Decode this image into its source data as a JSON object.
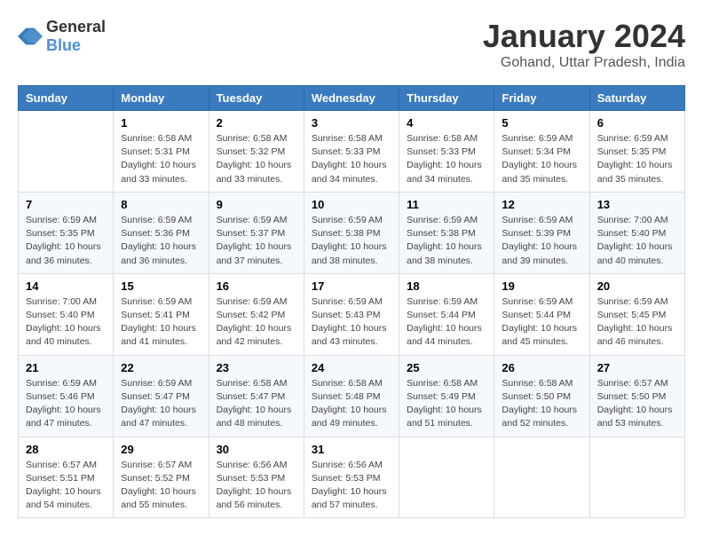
{
  "header": {
    "logo_general": "General",
    "logo_blue": "Blue",
    "month": "January 2024",
    "location": "Gohand, Uttar Pradesh, India"
  },
  "weekdays": [
    "Sunday",
    "Monday",
    "Tuesday",
    "Wednesday",
    "Thursday",
    "Friday",
    "Saturday"
  ],
  "weeks": [
    [
      {
        "day": "",
        "sunrise": "",
        "sunset": "",
        "daylight": ""
      },
      {
        "day": "1",
        "sunrise": "Sunrise: 6:58 AM",
        "sunset": "Sunset: 5:31 PM",
        "daylight": "Daylight: 10 hours and 33 minutes."
      },
      {
        "day": "2",
        "sunrise": "Sunrise: 6:58 AM",
        "sunset": "Sunset: 5:32 PM",
        "daylight": "Daylight: 10 hours and 33 minutes."
      },
      {
        "day": "3",
        "sunrise": "Sunrise: 6:58 AM",
        "sunset": "Sunset: 5:33 PM",
        "daylight": "Daylight: 10 hours and 34 minutes."
      },
      {
        "day": "4",
        "sunrise": "Sunrise: 6:58 AM",
        "sunset": "Sunset: 5:33 PM",
        "daylight": "Daylight: 10 hours and 34 minutes."
      },
      {
        "day": "5",
        "sunrise": "Sunrise: 6:59 AM",
        "sunset": "Sunset: 5:34 PM",
        "daylight": "Daylight: 10 hours and 35 minutes."
      },
      {
        "day": "6",
        "sunrise": "Sunrise: 6:59 AM",
        "sunset": "Sunset: 5:35 PM",
        "daylight": "Daylight: 10 hours and 35 minutes."
      }
    ],
    [
      {
        "day": "7",
        "sunrise": "Sunrise: 6:59 AM",
        "sunset": "Sunset: 5:35 PM",
        "daylight": "Daylight: 10 hours and 36 minutes."
      },
      {
        "day": "8",
        "sunrise": "Sunrise: 6:59 AM",
        "sunset": "Sunset: 5:36 PM",
        "daylight": "Daylight: 10 hours and 36 minutes."
      },
      {
        "day": "9",
        "sunrise": "Sunrise: 6:59 AM",
        "sunset": "Sunset: 5:37 PM",
        "daylight": "Daylight: 10 hours and 37 minutes."
      },
      {
        "day": "10",
        "sunrise": "Sunrise: 6:59 AM",
        "sunset": "Sunset: 5:38 PM",
        "daylight": "Daylight: 10 hours and 38 minutes."
      },
      {
        "day": "11",
        "sunrise": "Sunrise: 6:59 AM",
        "sunset": "Sunset: 5:38 PM",
        "daylight": "Daylight: 10 hours and 38 minutes."
      },
      {
        "day": "12",
        "sunrise": "Sunrise: 6:59 AM",
        "sunset": "Sunset: 5:39 PM",
        "daylight": "Daylight: 10 hours and 39 minutes."
      },
      {
        "day": "13",
        "sunrise": "Sunrise: 7:00 AM",
        "sunset": "Sunset: 5:40 PM",
        "daylight": "Daylight: 10 hours and 40 minutes."
      }
    ],
    [
      {
        "day": "14",
        "sunrise": "Sunrise: 7:00 AM",
        "sunset": "Sunset: 5:40 PM",
        "daylight": "Daylight: 10 hours and 40 minutes."
      },
      {
        "day": "15",
        "sunrise": "Sunrise: 6:59 AM",
        "sunset": "Sunset: 5:41 PM",
        "daylight": "Daylight: 10 hours and 41 minutes."
      },
      {
        "day": "16",
        "sunrise": "Sunrise: 6:59 AM",
        "sunset": "Sunset: 5:42 PM",
        "daylight": "Daylight: 10 hours and 42 minutes."
      },
      {
        "day": "17",
        "sunrise": "Sunrise: 6:59 AM",
        "sunset": "Sunset: 5:43 PM",
        "daylight": "Daylight: 10 hours and 43 minutes."
      },
      {
        "day": "18",
        "sunrise": "Sunrise: 6:59 AM",
        "sunset": "Sunset: 5:44 PM",
        "daylight": "Daylight: 10 hours and 44 minutes."
      },
      {
        "day": "19",
        "sunrise": "Sunrise: 6:59 AM",
        "sunset": "Sunset: 5:44 PM",
        "daylight": "Daylight: 10 hours and 45 minutes."
      },
      {
        "day": "20",
        "sunrise": "Sunrise: 6:59 AM",
        "sunset": "Sunset: 5:45 PM",
        "daylight": "Daylight: 10 hours and 46 minutes."
      }
    ],
    [
      {
        "day": "21",
        "sunrise": "Sunrise: 6:59 AM",
        "sunset": "Sunset: 5:46 PM",
        "daylight": "Daylight: 10 hours and 47 minutes."
      },
      {
        "day": "22",
        "sunrise": "Sunrise: 6:59 AM",
        "sunset": "Sunset: 5:47 PM",
        "daylight": "Daylight: 10 hours and 47 minutes."
      },
      {
        "day": "23",
        "sunrise": "Sunrise: 6:58 AM",
        "sunset": "Sunset: 5:47 PM",
        "daylight": "Daylight: 10 hours and 48 minutes."
      },
      {
        "day": "24",
        "sunrise": "Sunrise: 6:58 AM",
        "sunset": "Sunset: 5:48 PM",
        "daylight": "Daylight: 10 hours and 49 minutes."
      },
      {
        "day": "25",
        "sunrise": "Sunrise: 6:58 AM",
        "sunset": "Sunset: 5:49 PM",
        "daylight": "Daylight: 10 hours and 51 minutes."
      },
      {
        "day": "26",
        "sunrise": "Sunrise: 6:58 AM",
        "sunset": "Sunset: 5:50 PM",
        "daylight": "Daylight: 10 hours and 52 minutes."
      },
      {
        "day": "27",
        "sunrise": "Sunrise: 6:57 AM",
        "sunset": "Sunset: 5:50 PM",
        "daylight": "Daylight: 10 hours and 53 minutes."
      }
    ],
    [
      {
        "day": "28",
        "sunrise": "Sunrise: 6:57 AM",
        "sunset": "Sunset: 5:51 PM",
        "daylight": "Daylight: 10 hours and 54 minutes."
      },
      {
        "day": "29",
        "sunrise": "Sunrise: 6:57 AM",
        "sunset": "Sunset: 5:52 PM",
        "daylight": "Daylight: 10 hours and 55 minutes."
      },
      {
        "day": "30",
        "sunrise": "Sunrise: 6:56 AM",
        "sunset": "Sunset: 5:53 PM",
        "daylight": "Daylight: 10 hours and 56 minutes."
      },
      {
        "day": "31",
        "sunrise": "Sunrise: 6:56 AM",
        "sunset": "Sunset: 5:53 PM",
        "daylight": "Daylight: 10 hours and 57 minutes."
      },
      {
        "day": "",
        "sunrise": "",
        "sunset": "",
        "daylight": ""
      },
      {
        "day": "",
        "sunrise": "",
        "sunset": "",
        "daylight": ""
      },
      {
        "day": "",
        "sunrise": "",
        "sunset": "",
        "daylight": ""
      }
    ]
  ]
}
